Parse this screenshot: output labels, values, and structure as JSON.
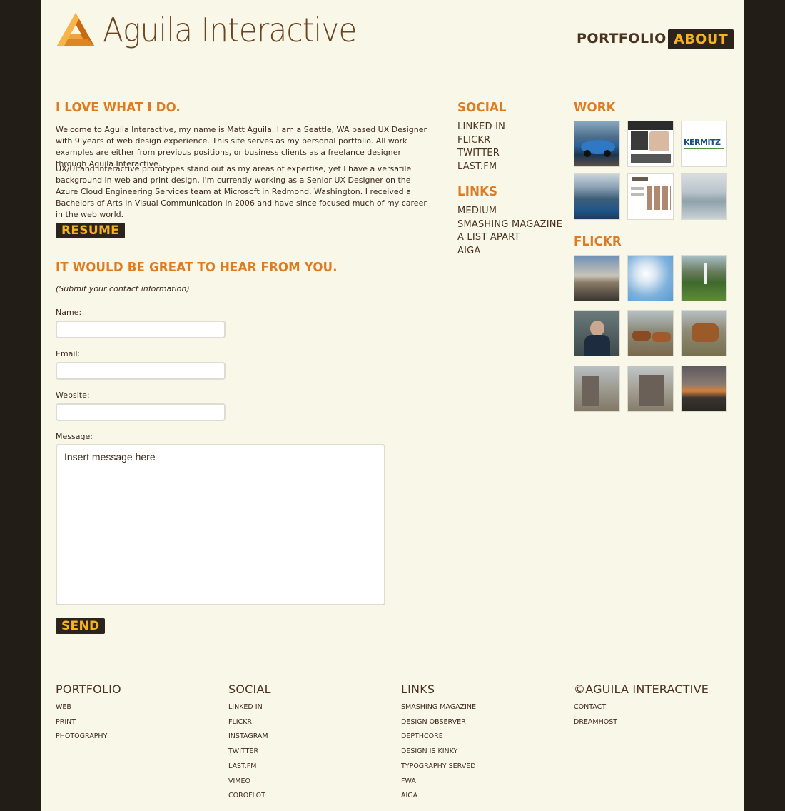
{
  "brand": {
    "name": "Aguila Interactive"
  },
  "nav": {
    "portfolio": "PORTFOLIO",
    "about": "ABOUT"
  },
  "about": {
    "heading": "I LOVE WHAT I DO.",
    "p1": "Welcome to Aguila Interactive, my name is Matt Aguila. I am a Seattle, WA based UX Designer with 9 years of web design experience. This site serves as my personal portfolio. All work examples are either from previous positions, or business clients as a freelance designer through Aguila Interactive.",
    "p2": "UX/UI and interactive prototypes stand out as my areas of expertise, yet I have a versatile background in web and print design. I'm currently working as a Senior UX Designer on the Azure Cloud Engineering Services team at Microsoft in Redmond, Washington. I received a Bachelors of Arts in Visual Communication in 2006 and have since focused much of my career in the web world.",
    "resume": "RESUME"
  },
  "contact": {
    "heading": "IT WOULD BE GREAT TO HEAR FROM YOU.",
    "note": "(Submit your contact information)",
    "name_label": "Name:",
    "email_label": "Email:",
    "website_label": "Website:",
    "message_label": "Message:",
    "message_value": "Insert message here",
    "send": "SEND"
  },
  "social": {
    "heading": "SOCIAL",
    "items": [
      "LINKED IN",
      "FLICKR",
      "TWITTER",
      "LAST.FM"
    ]
  },
  "links": {
    "heading": "LINKS",
    "items": [
      "MEDIUM",
      "SMASHING MAGAZINE",
      "A LIST APART",
      "AIGA"
    ]
  },
  "work": {
    "heading": "WORK",
    "thumb_text": "KERMITZ"
  },
  "flickr": {
    "heading": "FLICKR"
  },
  "footer": {
    "portfolio": {
      "heading": "PORTFOLIO",
      "items": [
        "WEB",
        "PRINT",
        "PHOTOGRAPHY"
      ]
    },
    "social": {
      "heading": "SOCIAL",
      "items": [
        "LINKED IN",
        "FLICKR",
        "INSTAGRAM",
        "TWITTER",
        "LAST.FM",
        "VIMEO",
        "COROFLOT"
      ]
    },
    "links": {
      "heading": "LINKS",
      "items": [
        "SMASHING MAGAZINE",
        "DESIGN OBSERVER",
        "DEPTHCORE",
        "DESIGN IS KINKY",
        "TYPOGRAPHY SERVED",
        "FWA",
        "AIGA"
      ]
    },
    "copyright": {
      "heading": "©AGUILA INTERACTIVE",
      "items": [
        "CONTACT",
        "DREAMHOST"
      ]
    }
  },
  "colors": {
    "accent": "#e07a1f",
    "button_bg": "#2b231c",
    "button_text": "#f7b21f",
    "page_bg": "#f9f7e8",
    "outer_bg": "#231d18"
  }
}
